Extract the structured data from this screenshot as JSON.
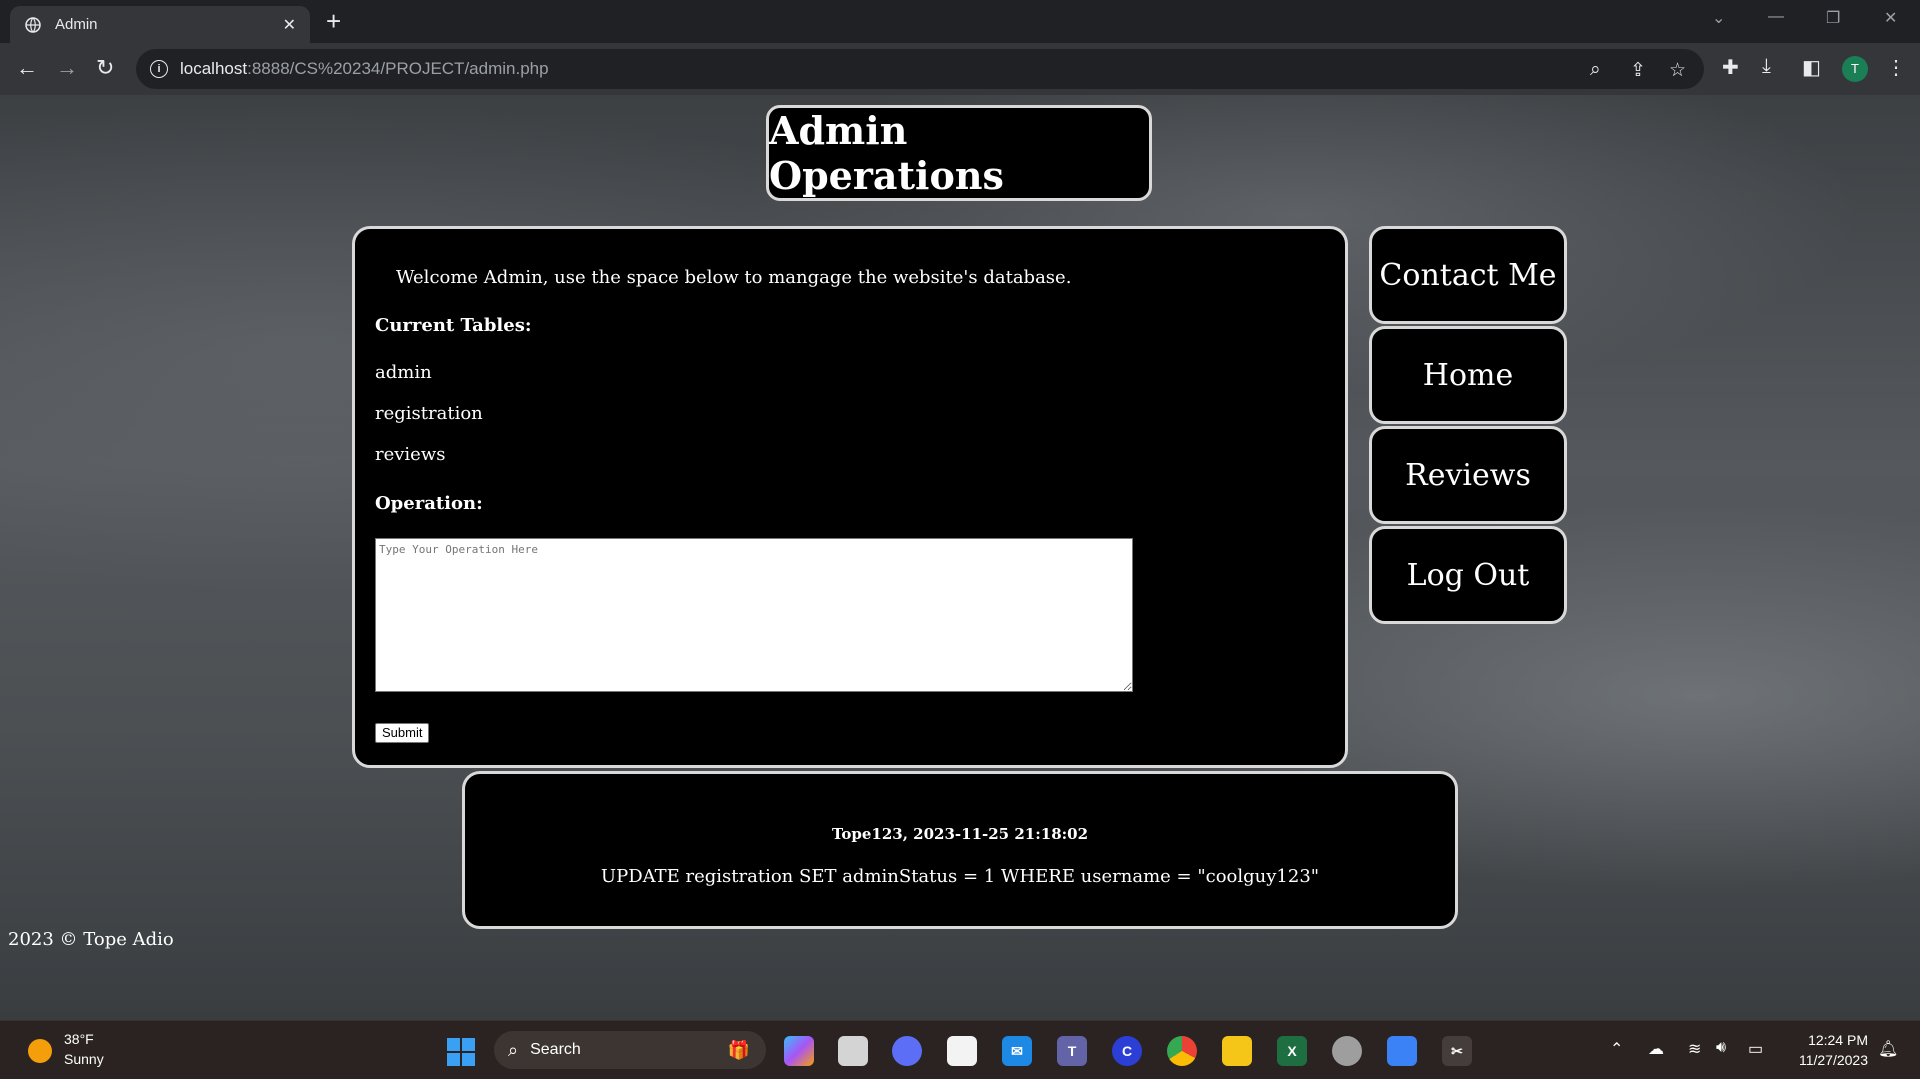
{
  "browser": {
    "tab_title": "Admin",
    "url_host": "localhost",
    "url_rest": ":8888/CS%20234/PROJECT/admin.php",
    "profile_initial": "T"
  },
  "page": {
    "heading": "Admin Operations",
    "welcome": "Welcome Admin, use the space below to mangage the website's database.",
    "tables_title": "Current Tables:",
    "tables": [
      "admin",
      "registration",
      "reviews"
    ],
    "operation_title": "Operation:",
    "operation_placeholder": "Type Your Operation Here",
    "submit_label": "Submit",
    "nav": [
      "Contact Me",
      "Home",
      "Reviews",
      "Log Out"
    ],
    "log": {
      "meta": "Tope123, 2023-11-25 21:18:02",
      "query": "UPDATE registration SET adminStatus = 1 WHERE username = \"coolguy123\""
    },
    "footer": "2023 © Tope Adio"
  },
  "taskbar": {
    "temperature": "38°F",
    "weather": "Sunny",
    "search_label": "Search",
    "time": "12:24 PM",
    "date": "11/27/2023",
    "apps": [
      "copilot",
      "task-view",
      "zoom",
      "store",
      "mail",
      "teams",
      "app",
      "chrome",
      "file-explorer",
      "excel",
      "app",
      "photos",
      "snipping-tool"
    ]
  },
  "colors": {
    "panel_bg": "#000000",
    "panel_border": "#d9d9d9",
    "chrome_dark": "#202124",
    "chrome_toolbar": "#35363a",
    "taskbar_bg": "#2b2321"
  }
}
